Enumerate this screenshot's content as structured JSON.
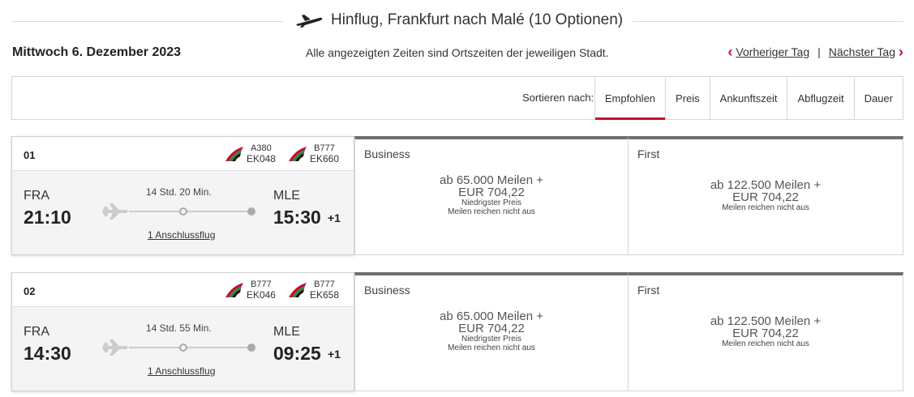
{
  "header": {
    "title": "Hinflug, Frankfurt nach Malé (10 Optionen)",
    "date": "Mittwoch 6. Dezember 2023",
    "timezone_note": "Alle angezeigten Zeiten sind Ortszeiten der jeweiligen Stadt.",
    "prev_day": "Vorheriger Tag",
    "next_day": "Nächster Tag",
    "separator": "|"
  },
  "sort": {
    "label": "Sortieren nach:",
    "options": [
      "Empfohlen",
      "Preis",
      "Ankunftszeit",
      "Abflugzeit",
      "Dauer"
    ],
    "active": "Empfohlen"
  },
  "colors": {
    "accent": "#c60c30",
    "fare_border_top": "#6e6e6e"
  },
  "flights": [
    {
      "number": "01",
      "carriers": [
        {
          "aircraft": "A380",
          "flight": "EK048"
        },
        {
          "aircraft": "B777",
          "flight": "EK660"
        }
      ],
      "origin": "FRA",
      "departure": "21:10",
      "destination": "MLE",
      "arrival": "15:30",
      "day_offset": "+1",
      "duration": "14 Std. 20 Min.",
      "connection": "1 Anschlussflug",
      "fares": {
        "business": {
          "class": "Business",
          "miles": "ab 65.000 Meilen +",
          "eur": "EUR 704,22",
          "note1": "Niedrigster Preis",
          "note2": "Meilen reichen nicht aus"
        },
        "first": {
          "class": "First",
          "miles": "ab 122.500 Meilen +",
          "eur": "EUR 704,22",
          "note1": "Meilen reichen nicht aus"
        }
      }
    },
    {
      "number": "02",
      "carriers": [
        {
          "aircraft": "B777",
          "flight": "EK046"
        },
        {
          "aircraft": "B777",
          "flight": "EK658"
        }
      ],
      "origin": "FRA",
      "departure": "14:30",
      "destination": "MLE",
      "arrival": "09:25",
      "day_offset": "+1",
      "duration": "14 Std. 55 Min.",
      "connection": "1 Anschlussflug",
      "fares": {
        "business": {
          "class": "Business",
          "miles": "ab 65.000 Meilen +",
          "eur": "EUR 704,22",
          "note1": "Niedrigster Preis",
          "note2": "Meilen reichen nicht aus"
        },
        "first": {
          "class": "First",
          "miles": "ab 122.500 Meilen +",
          "eur": "EUR 704,22",
          "note1": "Meilen reichen nicht aus"
        }
      }
    }
  ]
}
